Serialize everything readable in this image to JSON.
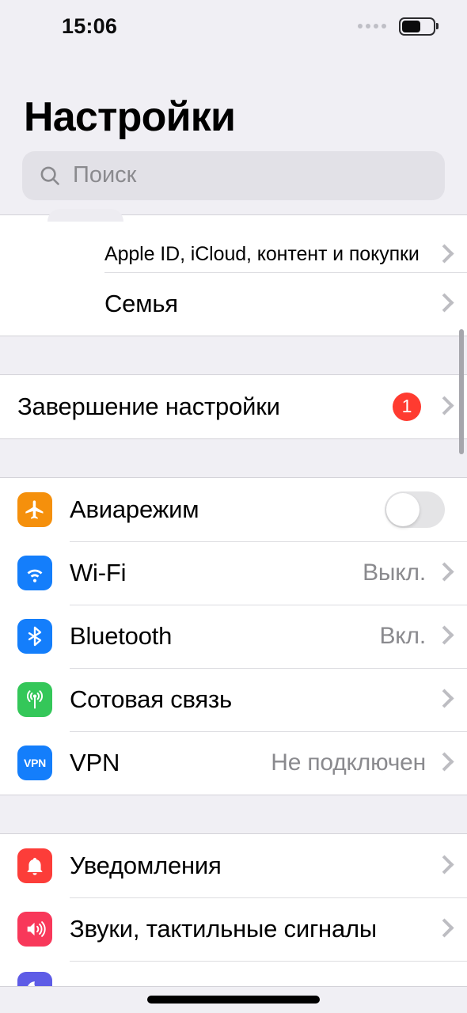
{
  "status_bar": {
    "time": "15:06",
    "signal_icon": "four-dots-signal-icon",
    "battery_icon": "battery-icon",
    "battery_level_percent": 60
  },
  "header": {
    "title": "Настройки"
  },
  "search": {
    "icon": "search-icon",
    "placeholder": "Поиск",
    "value": ""
  },
  "colors": {
    "page_background": "#F0EFF4",
    "card_background": "#FFFFFF",
    "separator": "#DCDCE0",
    "secondary_text": "#8A8A8E",
    "badge_red": "#FF3B30",
    "airplane_orange": "#F5900C",
    "wifi_blue": "#147EFB",
    "bluetooth_blue": "#147EFB",
    "cellular_green": "#34C759",
    "vpn_blue": "#147EFB",
    "notifications_red": "#FC3D39",
    "sounds_pink": "#F8385A",
    "focus_purple": "#5E5CE6"
  },
  "sections": [
    {
      "id": "account",
      "rows": [
        {
          "label": "Apple ID, iCloud, контент и покупки",
          "style": "small",
          "icon": null,
          "value": null,
          "accessory": "chevron",
          "clipped": true,
          "name": "row-apple-id"
        },
        {
          "label": "Семья",
          "style": "normal",
          "icon": null,
          "value": null,
          "accessory": "chevron",
          "name": "row-family"
        }
      ]
    },
    {
      "id": "setup",
      "rows": [
        {
          "label": "Завершение настройки",
          "style": "normal",
          "icon": null,
          "value": null,
          "accessory": "badge-chevron",
          "badge": "1",
          "name": "row-finish-setup"
        }
      ]
    },
    {
      "id": "connectivity",
      "rows": [
        {
          "label": "Авиарежим",
          "icon": "airplane-icon",
          "icon_color": "#F5900C",
          "value": null,
          "accessory": "toggle",
          "toggle_on": false,
          "name": "row-airplane-mode"
        },
        {
          "label": "Wi-Fi",
          "icon": "wifi-icon",
          "icon_color": "#147EFB",
          "value": "Выкл.",
          "accessory": "chevron",
          "name": "row-wifi"
        },
        {
          "label": "Bluetooth",
          "icon": "bluetooth-icon",
          "icon_color": "#147EFB",
          "value": "Вкл.",
          "accessory": "chevron",
          "name": "row-bluetooth"
        },
        {
          "label": "Сотовая связь",
          "icon": "cellular-icon",
          "icon_color": "#34C759",
          "value": null,
          "accessory": "chevron",
          "name": "row-cellular"
        },
        {
          "label": "VPN",
          "icon": "vpn-icon",
          "icon_color": "#147EFB",
          "value": "Не подключен",
          "accessory": "chevron",
          "name": "row-vpn"
        }
      ]
    },
    {
      "id": "alerts",
      "rows": [
        {
          "label": "Уведомления",
          "icon": "bell-icon",
          "icon_color": "#FC3D39",
          "value": null,
          "accessory": "chevron",
          "name": "row-notifications"
        },
        {
          "label": "Звуки, тактильные сигналы",
          "icon": "speaker-icon",
          "icon_color": "#F8385A",
          "value": null,
          "accessory": "chevron",
          "name": "row-sounds-haptics"
        },
        {
          "label": "",
          "icon": "focus-icon",
          "icon_color": "#5E5CE6",
          "value": null,
          "accessory": "none",
          "partially_visible": true,
          "name": "row-focus"
        }
      ]
    }
  ],
  "home_indicator": "home-indicator"
}
